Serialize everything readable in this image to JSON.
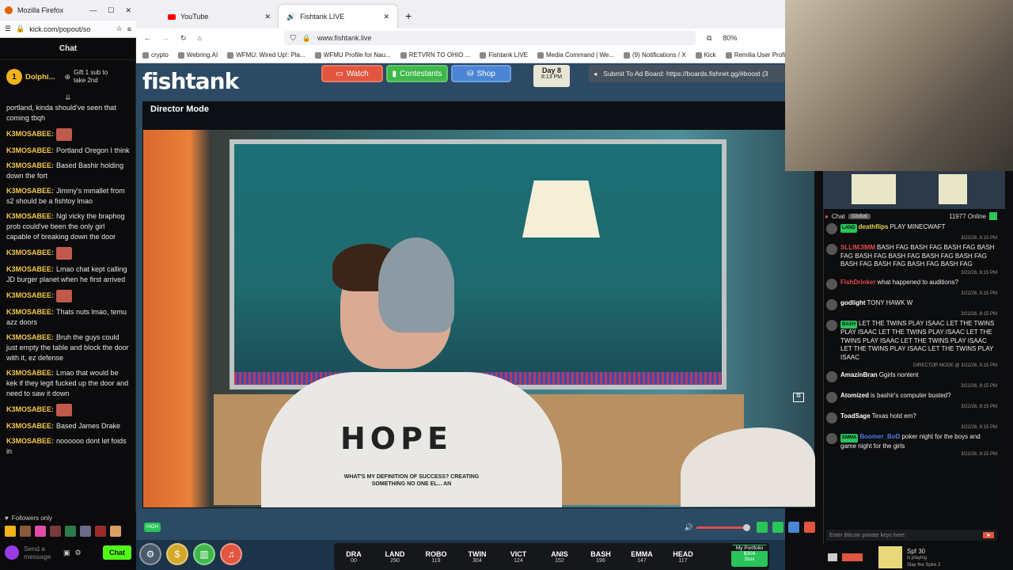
{
  "left_window": {
    "title": "Mozilla Firefox",
    "url": "kick.com/popout/so",
    "chat_header": "Chat",
    "pinned": {
      "user": "Dolphi...",
      "level": "1",
      "gift_text": "Gift 1 sub to take 2nd"
    },
    "messages": [
      {
        "user": "",
        "text": "portland, kinda should've seen that coming tbqh"
      },
      {
        "user": "K3MOSABEE:",
        "text": "",
        "emote": true
      },
      {
        "user": "K3MOSABEE:",
        "text": "Portland Oregon I think"
      },
      {
        "user": "K3MOSABEE:",
        "text": "Based Bashir holding down the fort"
      },
      {
        "user": "K3MOSABEE:",
        "text": "Jimmy's mmallet from s2 should be a fishtoy lmao"
      },
      {
        "user": "K3MOSABEE:",
        "text": "Ngl vicky the braphog prob could've been the only girl capable of breaking down the door"
      },
      {
        "user": "K3MOSABEE:",
        "text": "",
        "emote": true
      },
      {
        "user": "K3MOSABEE:",
        "text": "Lmao chat kept calling JD burger planet when he first arrived"
      },
      {
        "user": "K3MOSABEE:",
        "text": "",
        "emote": true
      },
      {
        "user": "K3MOSABEE:",
        "text": "Thats nuts lmao, temu azz doors"
      },
      {
        "user": "K3MOSABEE:",
        "text": "Bruh the guys could just empty the table and block the door with it, ez defense"
      },
      {
        "user": "K3MOSABEE:",
        "text": "Lmao that would be kek if they legit fucked up the door and need to saw it down"
      },
      {
        "user": "K3MOSABEE:",
        "text": "",
        "emote": true
      },
      {
        "user": "K3MOSABEE:",
        "text": "Based James Drake"
      },
      {
        "user": "K3MOSABEE:",
        "text": "noooooo dont let foids in"
      }
    ],
    "followers_only": "Followers only",
    "send_placeholder": "Send a message",
    "chat_button": "Chat"
  },
  "browser": {
    "tabs": [
      {
        "label": "YouTube"
      },
      {
        "label": "Fishtank LIVE"
      }
    ],
    "url": "www.fishtank.live",
    "zoom": "80%",
    "bookmarks": [
      "crypto",
      "Webring.AI",
      "WFMU: Wired Up!: Pla...",
      "WFMU Profile for Nau...",
      "RETVRN TO OHIO ...",
      "Fishtank LIVE",
      "Media Command | We...",
      "(9) Notifications / X",
      "Kick",
      "Remilia User Profiles"
    ]
  },
  "site": {
    "logo": "fishtank",
    "nav": {
      "watch": "Watch",
      "contestants": "Contestants",
      "shop": "Shop"
    },
    "day": "Day 8",
    "time": "8:13 PM",
    "ad_board": "Submit To Ad Board: https://boards.fishnet.gg/#boost (3",
    "director_title": "Director Mode",
    "shirt_text": "HOPE",
    "shirt_sub": "WHAT'S MY DEFINITION OF SUCCESS? CREATING SOMETHING NO ONE EL... AN",
    "quality": "HIGH",
    "ticker": [
      {
        "name": "DRA",
        "price": "00"
      },
      {
        "name": "LAND",
        "price": "290"
      },
      {
        "name": "ROBO",
        "price": "119"
      },
      {
        "name": "TWIN",
        "price": "304"
      },
      {
        "name": "VICT",
        "price": "124"
      },
      {
        "name": "ANIS",
        "price": "152"
      },
      {
        "name": "BASH",
        "price": "196"
      },
      {
        "name": "EMMA",
        "price": "147"
      },
      {
        "name": "HEAD",
        "price": "117"
      }
    ],
    "portfolio": {
      "label": "My Portfolio",
      "value": "$304",
      "button": "Stox"
    }
  },
  "right_chat": {
    "header": "Chat",
    "tab": "Global",
    "online": "11977 Online",
    "messages": [
      {
        "user": "deathflips",
        "badge": "LAND",
        "text": "PLAY MINECWAFT",
        "time": "3/22/26, 8:15 PM",
        "color": "#e6d44a"
      },
      {
        "user": "SLLIMJIMM",
        "badge": "",
        "text": "BASH FAG BASH FAG BASH FAG BASH FAG BASH FAG BASH FAG BASH FAG BASH FAG BASH FAG BASH FAG BASH FAG BASH FAG",
        "time": "3/22/26, 8:15 PM",
        "color": "#e24c4c"
      },
      {
        "user": "FishDrinker",
        "badge": "",
        "text": "what happened to auditions?",
        "time": "3/22/26, 8:15 PM",
        "color": "#e24c4c"
      },
      {
        "user": "godlight",
        "badge": "",
        "text": "TONY HAWK W",
        "time": "3/22/26, 8:15 PM",
        "color": "#ffffff"
      },
      {
        "user": "",
        "badge": "BASH",
        "text": "LET THE TWINS PLAY ISAAC LET THE TWINS PLAY ISAAC LET THE TWINS PLAY ISAAC LET THE TWINS PLAY ISAAC LET THE TWINS PLAY ISAAC LET THE TWINS PLAY ISAAC LET THE TWINS PLAY ISAAC",
        "time": "DIRECTOR MODE @ 3/22/26, 8:15 PM",
        "color": "#ffffff"
      },
      {
        "user": "AmazinBran",
        "badge": "",
        "text": "Ggirls nontent",
        "time": "3/22/26, 8:15 PM",
        "color": "#ffffff"
      },
      {
        "user": "Atomized",
        "badge": "",
        "text": "is bashir's computer busted?",
        "time": "3/22/26, 8:15 PM",
        "color": "#ffffff"
      },
      {
        "user": "ToadSage",
        "badge": "",
        "text": "Texas hold em?",
        "time": "3/22/26, 8:15 PM",
        "color": "#ffffff"
      },
      {
        "user": "Boomer_BoD",
        "badge": "EMMA",
        "text": "poker night for the boys and game night for the girls",
        "time": "3/22/26, 8:15 PM",
        "color": "#4a7ae6"
      }
    ],
    "input_placeholder": "Enter Bitcoin private keys here:",
    "status": {
      "name": "Spf 30",
      "line": "is playing",
      "game": "Slay the Spire 2"
    }
  }
}
